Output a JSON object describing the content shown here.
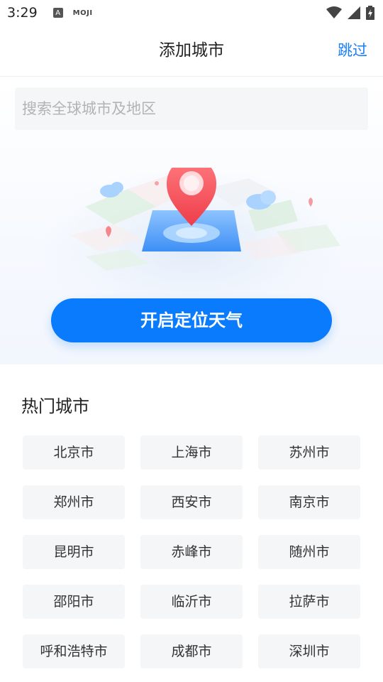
{
  "status": {
    "time": "3:29",
    "app_icon_text": "A",
    "app_text": "MOJI"
  },
  "header": {
    "title": "添加城市",
    "skip_label": "跳过"
  },
  "search": {
    "placeholder": "搜索全球城市及地区"
  },
  "locate_button": {
    "label": "开启定位天气"
  },
  "hot_cities": {
    "title": "热门城市",
    "items": [
      "北京市",
      "上海市",
      "苏州市",
      "郑州市",
      "西安市",
      "南京市",
      "昆明市",
      "赤峰市",
      "随州市",
      "邵阳市",
      "临沂市",
      "拉萨市",
      "呼和浩特市",
      "成都市",
      "深圳市"
    ]
  },
  "colors": {
    "accent": "#0a7bfc",
    "skip": "#1a7ef5",
    "pin": "#f4505a"
  }
}
